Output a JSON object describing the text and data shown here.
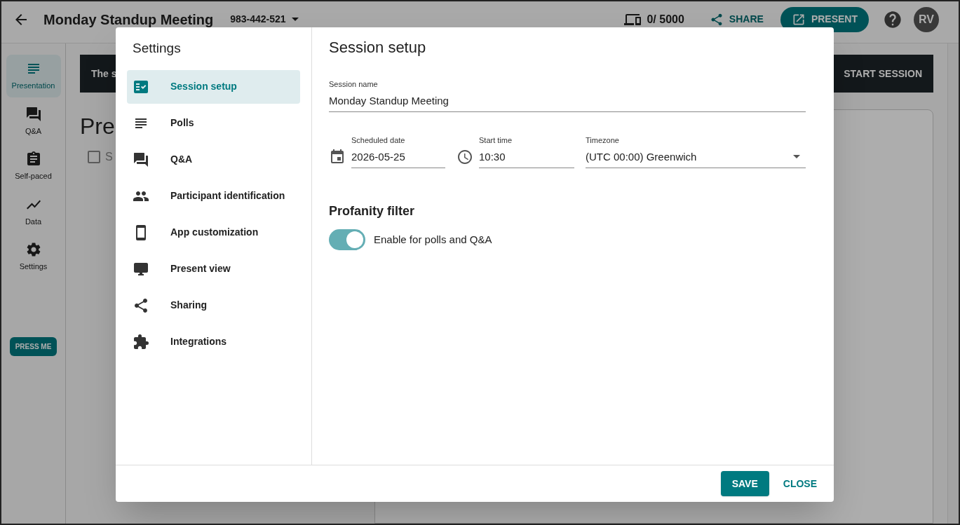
{
  "header": {
    "title": "Monday Standup Meeting",
    "code": "983-442-521",
    "participants": "0/ 5000",
    "share": "SHARE",
    "present": "PRESENT",
    "avatar": "RV"
  },
  "sidebar": {
    "items": [
      {
        "label": "Presentation",
        "selected": true
      },
      {
        "label": "Q&A",
        "selected": false
      },
      {
        "label": "Self-paced",
        "selected": false
      },
      {
        "label": "Data",
        "selected": false
      },
      {
        "label": "Settings",
        "selected": false
      }
    ],
    "press_me": "PRESS ME"
  },
  "banner": {
    "text": "The s",
    "action": "START SESSION"
  },
  "content": {
    "heading": "Pre",
    "checkbox": {
      "label": "S",
      "checked": false
    }
  },
  "dialog": {
    "title": "Settings",
    "nav": [
      {
        "label": "Session setup",
        "selected": true
      },
      {
        "label": "Polls",
        "selected": false
      },
      {
        "label": "Q&A",
        "selected": false
      },
      {
        "label": "Participant identification",
        "selected": false
      },
      {
        "label": "App customization",
        "selected": false
      },
      {
        "label": "Present view",
        "selected": false
      },
      {
        "label": "Sharing",
        "selected": false
      },
      {
        "label": "Integrations",
        "selected": false
      }
    ],
    "heading": "Session setup",
    "session_name": {
      "label": "Session name",
      "value": "Monday Standup Meeting"
    },
    "scheduled_date": {
      "label": "Scheduled date",
      "value": "2026-05-25"
    },
    "start_time": {
      "label": "Start time",
      "value": "10:30"
    },
    "timezone": {
      "label": "Timezone",
      "value": "(UTC 00:00) Greenwich"
    },
    "profanity": {
      "heading": "Profanity filter",
      "label": "Enable for polls and Q&A",
      "on": true
    },
    "buttons": {
      "save": "SAVE",
      "close": "CLOSE"
    }
  }
}
